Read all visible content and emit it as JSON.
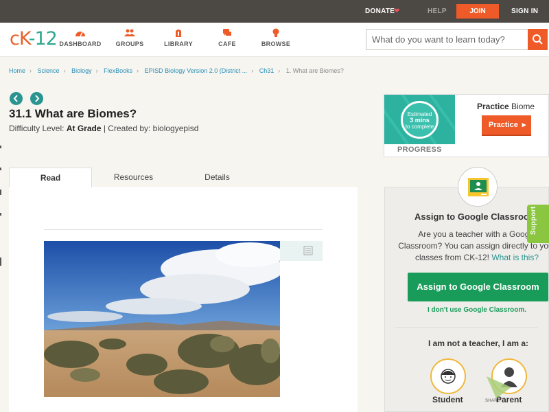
{
  "topbar": {
    "donate": "DONATE",
    "help": "HELP",
    "join": "JOIN",
    "signin": "SIGN IN"
  },
  "header": {
    "logo": "CK-12",
    "nav": [
      {
        "label": "DASHBOARD",
        "icon": "dashboard-icon"
      },
      {
        "label": "GROUPS",
        "icon": "groups-icon"
      },
      {
        "label": "LIBRARY",
        "icon": "library-icon"
      },
      {
        "label": "CAFE",
        "icon": "cafe-icon"
      },
      {
        "label": "BROWSE",
        "icon": "browse-icon"
      }
    ],
    "search_placeholder": "What do you want to learn today?"
  },
  "breadcrumb": {
    "items": [
      "Home",
      "Science",
      "Biology",
      "FlexBooks",
      "EPISD Biology Version 2.0 (District ...",
      "Ch31"
    ],
    "current": "1. What are Biomes?"
  },
  "lesson": {
    "title": "31.1 What are Biomes?",
    "difficulty_label": "Difficulty Level:",
    "difficulty_value": "At Grade",
    "created_by": "| Created by: biologyepisd"
  },
  "tabs": [
    {
      "label": "Read",
      "active": true
    },
    {
      "label": "Resources",
      "active": false
    },
    {
      "label": "Details",
      "active": false
    }
  ],
  "practice": {
    "estimated_line1": "Estimated",
    "estimated_line2": "3 mins",
    "estimated_line3": "to complete",
    "progress": "PROGRESS",
    "title_prefix": "Practice",
    "title_subject": "Biome",
    "button": "Practice"
  },
  "assign": {
    "title": "Assign to Google Classroom",
    "text_1": "Are you a teacher with a Google",
    "text_2": "Classroom? You can assign directly to your",
    "text_3": "classes from CK-12!",
    "what_link": "What is this?",
    "button": "Assign to Google Classroom",
    "dont_use": "I don't use Google Classroom.",
    "not_teacher": "I am not a teacher, I am a:",
    "roles": [
      "Student",
      "Parent"
    ]
  },
  "support": "Support",
  "share": "SHARE",
  "colors": {
    "accent_orange": "#ef5b28",
    "teal": "#2a9590",
    "google_green": "#199c5a",
    "support_green": "#8bc640"
  }
}
